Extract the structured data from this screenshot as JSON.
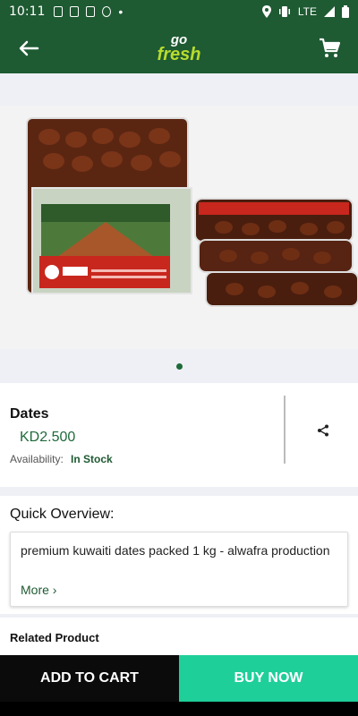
{
  "status_bar": {
    "time": "10:11",
    "network": "LTE"
  },
  "app_bar": {
    "logo_top": "go",
    "logo_bottom": "fresh"
  },
  "product": {
    "name": "Dates",
    "price": "KD2.500",
    "availability_label": "Availability:",
    "availability_value": "In Stock",
    "image_slides": 1
  },
  "overview": {
    "heading": "Quick Overview:",
    "description": "premium kuwaiti dates packed 1 kg - alwafra production",
    "more_label": "More ›"
  },
  "related": {
    "heading": "Related Product"
  },
  "actions": {
    "add_to_cart": "ADD TO CART",
    "buy_now": "BUY NOW"
  },
  "colors": {
    "primary": "#1e5a32",
    "accent_green": "#b9dc2e",
    "buy_now": "#1fcf9a",
    "add_cart": "#0b0b0b"
  },
  "icons": [
    "back-arrow-icon",
    "cart-icon",
    "share-icon"
  ]
}
